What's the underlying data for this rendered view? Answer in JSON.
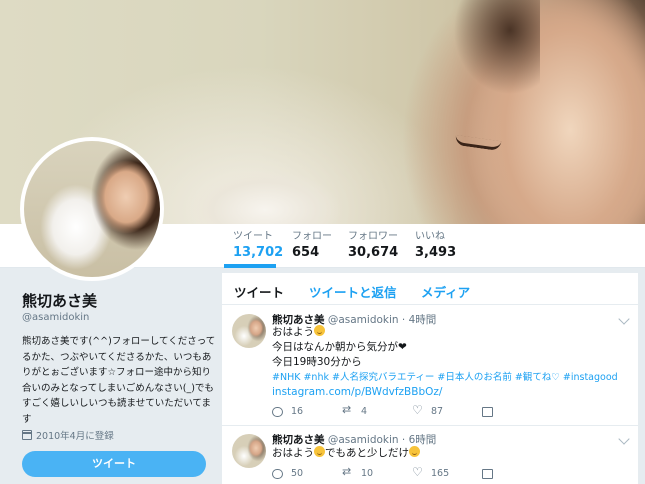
{
  "profile": {
    "name": "熊切あさ美",
    "handle": "@asamidokin",
    "bio": "熊切あさ美です(^^)フォローしてくださってるかた、つぶやいてくださるかた、いつもありがとぉございます☆フォロー途中から知り合いのみとなってしまいごめんなさい(_)でもすごく嬉しいしいつも読ませていただいてます",
    "joined": "2010年4月に登録",
    "tweet_button": "ツイート"
  },
  "stats": [
    {
      "label": "ツイート",
      "value": "13,702",
      "active": true
    },
    {
      "label": "フォロー",
      "value": "654"
    },
    {
      "label": "フォロワー",
      "value": "30,674"
    },
    {
      "label": "いいね",
      "value": "3,493"
    }
  ],
  "timeline_tabs": [
    "ツイート",
    "ツイートと返信",
    "メディア"
  ],
  "tweets": [
    {
      "name": "熊切あさ美",
      "handle": "@asamidokin",
      "time": "4時間",
      "lines": [
        "おはよう",
        "今日はなんか朝から気分が❤",
        "今日19時30分から"
      ],
      "hashtags": "#NHK #nhk #人名探究バラエティー #日本人のお名前 #観てね♡ #instagood",
      "link": "instagram.com/p/BWdvfzBBbOz/",
      "replies": "16",
      "retweets": "4",
      "likes": "87"
    },
    {
      "name": "熊切あさ美",
      "handle": "@asamidokin",
      "time": "6時間",
      "lines": [
        "おはよう",
        "でもあと少しだけ"
      ],
      "replies": "50",
      "retweets": "10",
      "likes": "165"
    }
  ],
  "colors": {
    "accent": "#1da1f2",
    "button": "#4ab3f4",
    "background": "#e6ecf0"
  }
}
